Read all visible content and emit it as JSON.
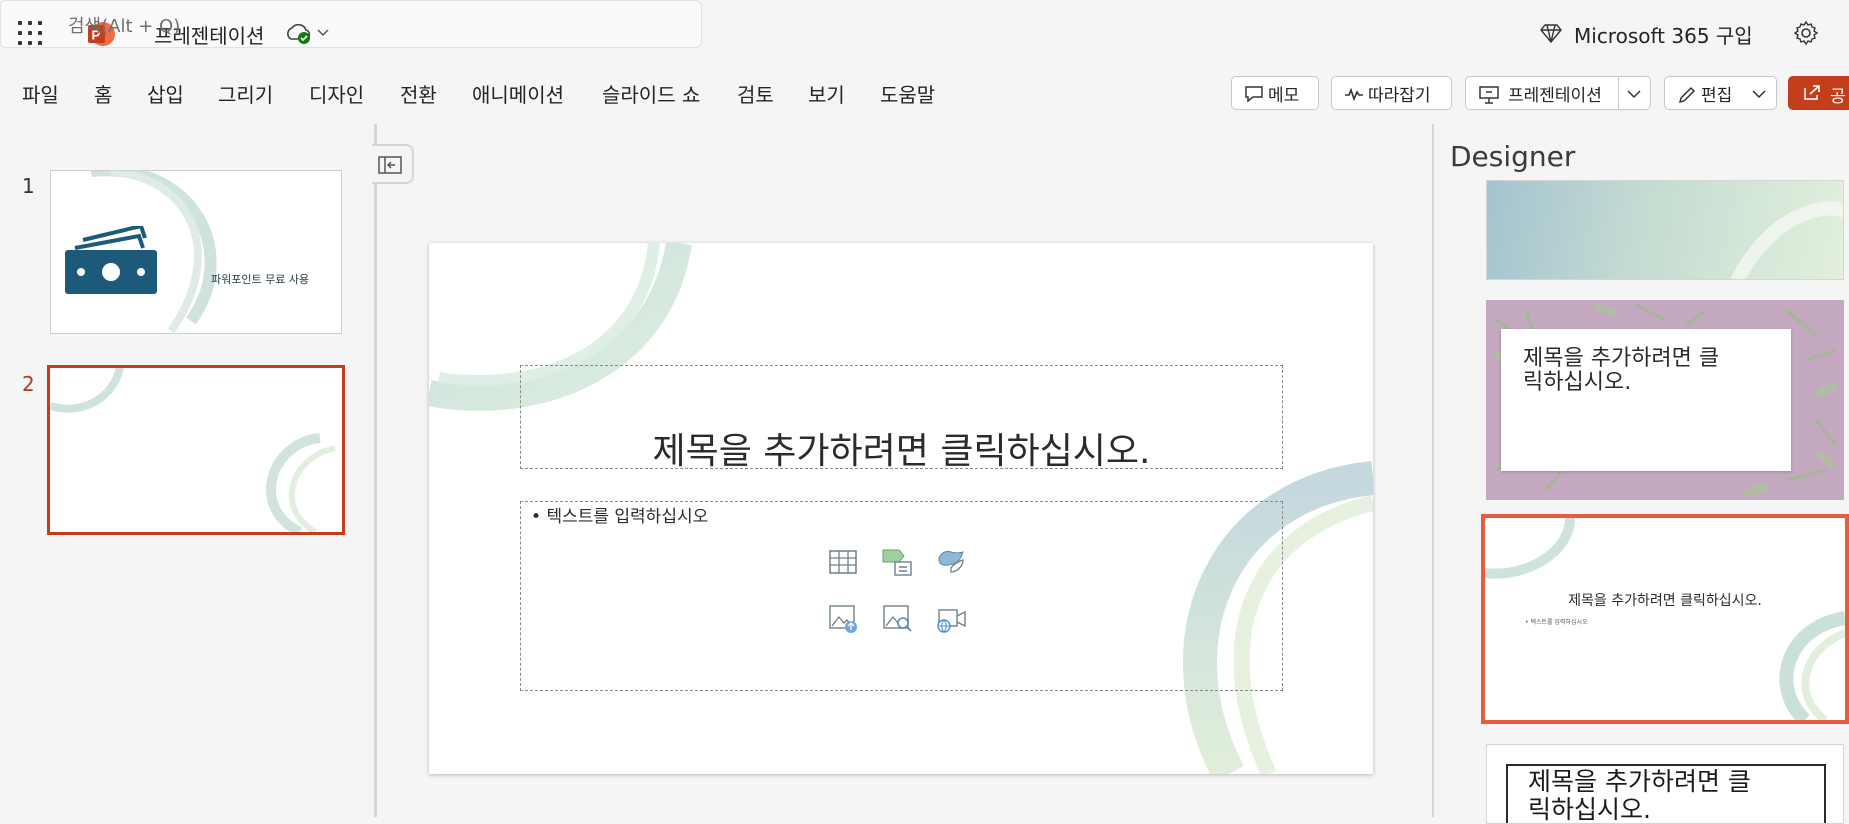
{
  "titlebar": {
    "doc_title": "프레젠테이션",
    "search_placeholder": "검색(Alt + Q)",
    "m365_label": "Microsoft 365 구입"
  },
  "ribbon": {
    "tabs": [
      "파일",
      "홈",
      "삽입",
      "그리기",
      "디자인",
      "전환",
      "애니메이션",
      "슬라이드 쇼",
      "검토",
      "보기",
      "도움말"
    ],
    "memo_label": "메모",
    "catchup_label": "따라잡기",
    "present_label": "프레젠테이션",
    "edit_label": "편집",
    "share_label": "공"
  },
  "thumbnails": [
    {
      "number": "1",
      "text": "파워포인트 무료 사용"
    },
    {
      "number": "2"
    }
  ],
  "slide": {
    "title": "제목을 추가하려면 클릭하십시오.",
    "bullet": "텍스트를 입력하십시오"
  },
  "designer": {
    "title": "Designer",
    "card2_title": "제목을 추가하려면 클릭하십시오.",
    "card3_title": "제목을 추가하려면 클릭하십시오.",
    "card3_bullet": "• 텍스트를 입력하십시오",
    "card4_title": "제목을 추가하려면 클릭하십시오."
  },
  "colors": {
    "accent": "#c43e1c",
    "designer_select": "#e65c3c"
  }
}
